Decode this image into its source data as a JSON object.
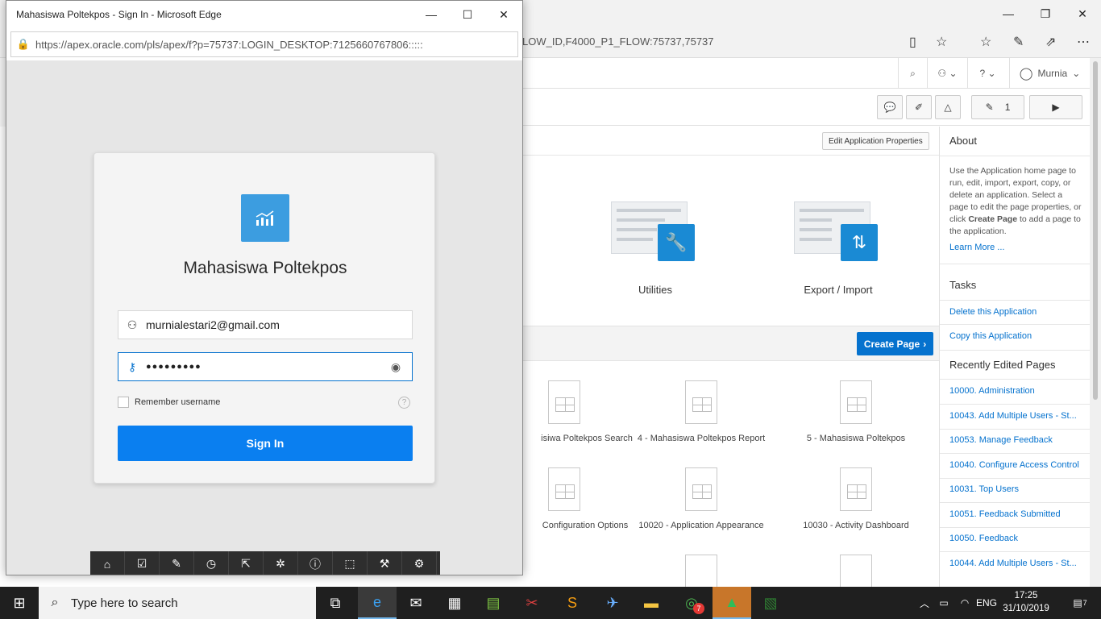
{
  "background": {
    "url_fragment": "LOW_ID,F4000_P1_FLOW:75737,75737",
    "user_name": "Murnia",
    "toolbar_count": "1",
    "edit_app_props_label": "Edit Application Properties",
    "tiles": [
      {
        "label": "Utilities",
        "icon": "wrench-icon"
      },
      {
        "label": "Export / Import",
        "icon": "import-export-icon"
      }
    ],
    "create_page_label": "Create Page",
    "pages": [
      {
        "label": "isiwa Poltekpos Search"
      },
      {
        "label": "4 - Mahasiswa Poltekpos Report"
      },
      {
        "label": "5 - Mahasiswa Poltekpos"
      },
      {
        "label": "Configuration Options"
      },
      {
        "label": "10020 - Application Appearance"
      },
      {
        "label": "10030 - Activity Dashboard"
      }
    ],
    "sidebar": {
      "about_title": "About",
      "about_text_1": "Use the Application home page to run, edit, import, export, copy, or delete an application. Select a page to edit the page properties, or click ",
      "about_text_bold": "Create Page",
      "about_text_2": " to add a page to the application.",
      "learn_more": "Learn More ...",
      "tasks_title": "Tasks",
      "tasks": [
        "Delete this Application",
        "Copy this Application"
      ],
      "recent_title": "Recently Edited Pages",
      "recent": [
        "10000. Administration",
        "10043. Add Multiple Users - St...",
        "10053. Manage Feedback",
        "10040. Configure Access Control",
        "10031. Top Users",
        "10051. Feedback Submitted",
        "10050. Feedback",
        "10044. Add Multiple Users - St..."
      ]
    }
  },
  "popup": {
    "window_title": "Mahasiswa Poltekpos - Sign In - Microsoft Edge",
    "url": "https://apex.oracle.com/pls/apex/f?p=75737:LOGIN_DESKTOP:7125660767806:::::",
    "app_title": "Mahasiswa Poltekpos",
    "username_value": "murnialestari2@gmail.com",
    "password_value": "●●●●●●●●●",
    "remember_label": "Remember username",
    "signin_label": "Sign In"
  },
  "taskbar": {
    "search_placeholder": "Type here to search",
    "language": "ENG",
    "time": "17:25",
    "date": "31/10/2019",
    "notification_count": "7",
    "chrome_badge": "7"
  }
}
